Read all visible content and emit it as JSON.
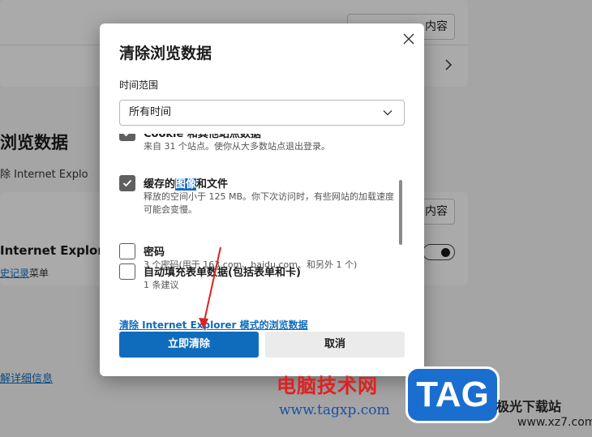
{
  "background": {
    "button_top": "内容",
    "heading": "浏览数据",
    "sub_text": "除 Internet Explo",
    "button_mid": "内容",
    "ie_title": "Internet Explorer",
    "history_link": "史记录",
    "history_suffix": "菜单",
    "learn_more": "解详细信息"
  },
  "dialog": {
    "title": "清除浏览数据",
    "time_range_label": "时间范围",
    "time_range_value": "所有时间",
    "items": [
      {
        "title": "Cookie 和其他站点数据",
        "desc": "来自 31 个站点。使你从大多数站点退出登录。",
        "checked": true
      },
      {
        "title_before": "缓存的",
        "title_highlight": "图像",
        "title_after": "和文件",
        "desc": "释放的空间小于 125 MB。你下次访问时，有些网站的加载速度可能会变慢。",
        "checked": true
      },
      {
        "title": "密码",
        "desc": "3 个密码(用于 163.com、baidu.com、和另外 1 个)",
        "checked": false
      },
      {
        "title": "自动填充表单数据(包括表单和卡)",
        "desc": "1 条建议",
        "checked": false
      }
    ],
    "ie_link": "清除 Internet Explorer 模式的浏览数据",
    "clear_button": "立即清除",
    "cancel_button": "取消"
  },
  "watermark": {
    "cn": "电脑技术网",
    "url": "www.tagxp.com",
    "tag": "TAG",
    "right_text": "极光下载站",
    "right_url": "www.xz7.com"
  },
  "colors": {
    "accent": "#0f6cbd",
    "checkbox": "#5f5f5f",
    "watermark_red": "#e02020",
    "tag_blue": "#1a6ecf"
  }
}
